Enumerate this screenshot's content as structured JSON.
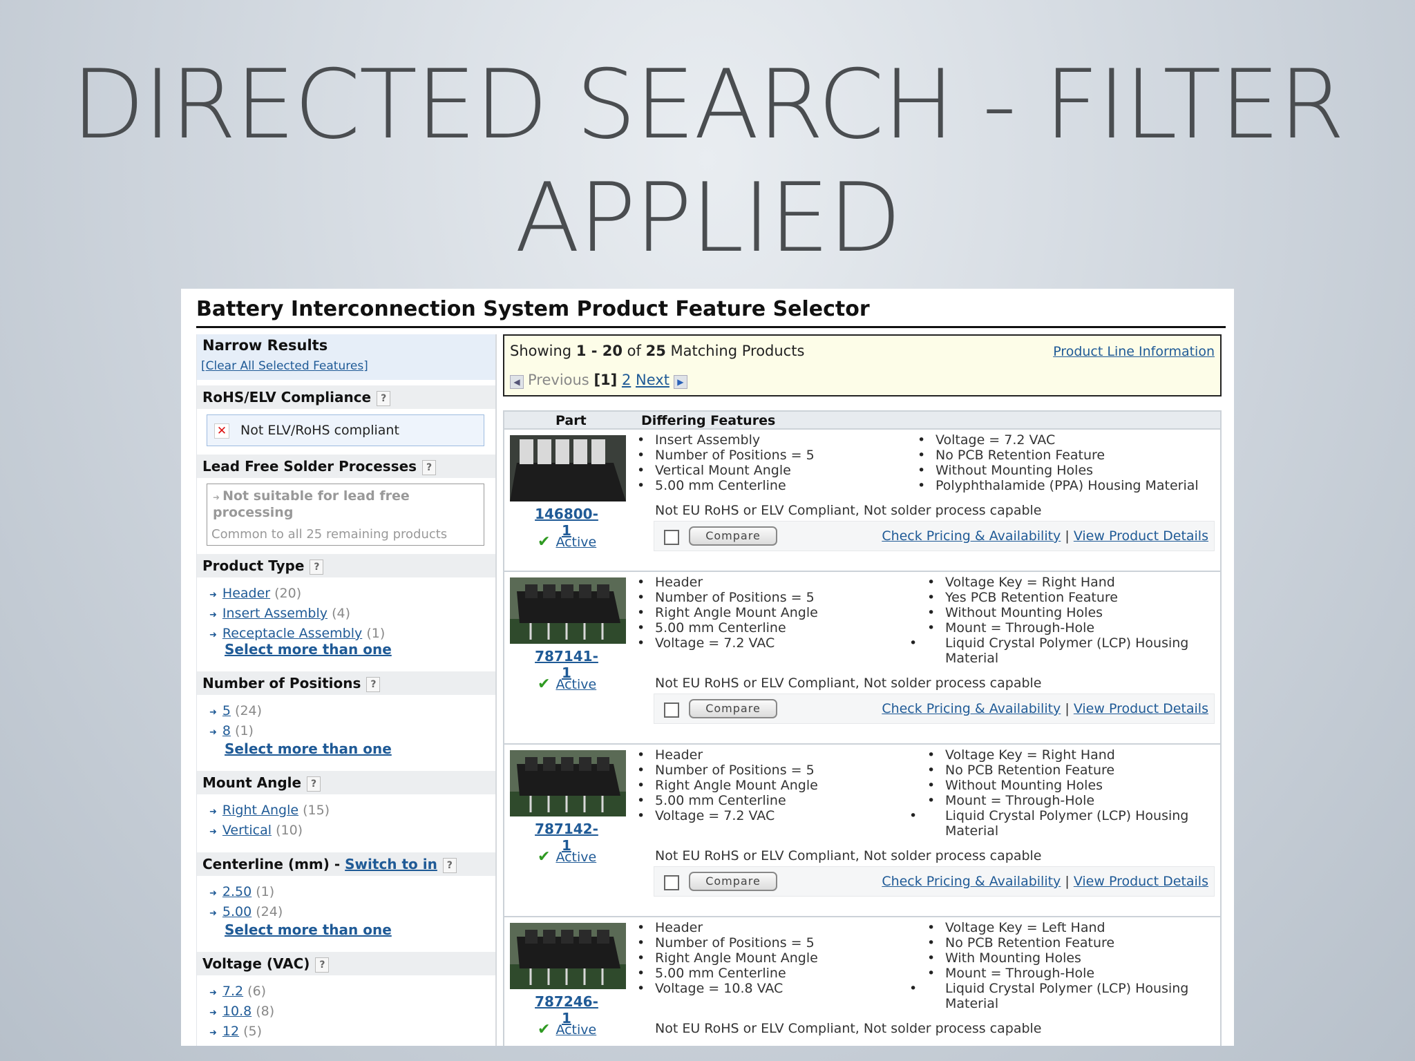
{
  "slide": {
    "title_line1": "DIRECTED SEARCH - FILTER",
    "title_line2": "APPLIED"
  },
  "page": {
    "title": "Battery Interconnection System Product Feature Selector"
  },
  "narrow": {
    "header": "Narrow Results",
    "clear_link": "[Clear All Selected Features]",
    "rohs": {
      "header": "RoHS/ELV Compliance",
      "selected": "Not ELV/RoHS compliant"
    },
    "lead": {
      "header": "Lead Free Solder Processes",
      "value": "Not suitable for lead free processing",
      "note": "Common to all 25 remaining products"
    },
    "product_type": {
      "header": "Product Type",
      "items": [
        {
          "label": "Header",
          "count": "(20)"
        },
        {
          "label": "Insert Assembly",
          "count": "(4)"
        },
        {
          "label": "Receptacle Assembly",
          "count": "(1)"
        }
      ],
      "more": "Select more than one"
    },
    "positions": {
      "header": "Number of Positions",
      "items": [
        {
          "label": "5",
          "count": "(24)"
        },
        {
          "label": "8",
          "count": "(1)"
        }
      ],
      "more": "Select more than one"
    },
    "mount": {
      "header": "Mount Angle",
      "items": [
        {
          "label": "Right Angle",
          "count": "(15)"
        },
        {
          "label": "Vertical",
          "count": "(10)"
        }
      ]
    },
    "centerline": {
      "header": "Centerline (mm) - ",
      "switch": "Switch to in",
      "items": [
        {
          "label": "2.50",
          "count": "(1)"
        },
        {
          "label": "5.00",
          "count": "(24)"
        }
      ],
      "more": "Select more than one"
    },
    "voltage": {
      "header": "Voltage (VAC)",
      "items": [
        {
          "label": "7.2",
          "count": "(6)"
        },
        {
          "label": "10.8",
          "count": "(8)"
        },
        {
          "label": "12",
          "count": "(5)"
        }
      ]
    }
  },
  "results": {
    "showing_prefix": "Showing ",
    "range": "1 - 20",
    "of": " of ",
    "total": "25",
    "suffix": " Matching Products",
    "product_line_link": "Product Line Information",
    "prev": "Previous",
    "current_page": "[1]",
    "page2": "2",
    "next": "Next",
    "col_part": "Part",
    "col_features": "Differing Features",
    "compare_label": "Compare",
    "pricing_link": "Check Pricing & Availability",
    "details_link": "View Product Details",
    "separator": "|",
    "compliance_note": "Not EU RoHS or ELV Compliant, Not solder process capable",
    "status": "Active",
    "products": [
      {
        "part": "146800-1",
        "left": [
          "Insert Assembly",
          "Number of Positions = 5",
          "Vertical Mount Angle",
          "5.00 mm Centerline"
        ],
        "right": [
          "Voltage = 7.2 VAC",
          "No PCB Retention Feature",
          "Without Mounting Holes",
          "Polyphthalamide (PPA) Housing Material"
        ]
      },
      {
        "part": "787141-1",
        "left": [
          "Header",
          "Number of Positions = 5",
          "Right Angle Mount Angle",
          "5.00 mm Centerline",
          "Voltage = 7.2 VAC"
        ],
        "right": [
          "Voltage Key = Right Hand",
          "Yes PCB Retention Feature",
          "Without Mounting Holes",
          "Mount = Through-Hole",
          "Liquid Crystal Polymer (LCP) Housing Material"
        ]
      },
      {
        "part": "787142-1",
        "left": [
          "Header",
          "Number of Positions = 5",
          "Right Angle Mount Angle",
          "5.00 mm Centerline",
          "Voltage = 7.2 VAC"
        ],
        "right": [
          "Voltage Key = Right Hand",
          "No PCB Retention Feature",
          "Without Mounting Holes",
          "Mount = Through-Hole",
          "Liquid Crystal Polymer (LCP) Housing Material"
        ]
      },
      {
        "part": "787246-1",
        "left": [
          "Header",
          "Number of Positions = 5",
          "Right Angle Mount Angle",
          "5.00 mm Centerline",
          "Voltage = 10.8 VAC"
        ],
        "right": [
          "Voltage Key = Left Hand",
          "No PCB Retention Feature",
          "With Mounting Holes",
          "Mount = Through-Hole",
          "Liquid Crystal Polymer (LCP) Housing Material"
        ]
      }
    ]
  }
}
